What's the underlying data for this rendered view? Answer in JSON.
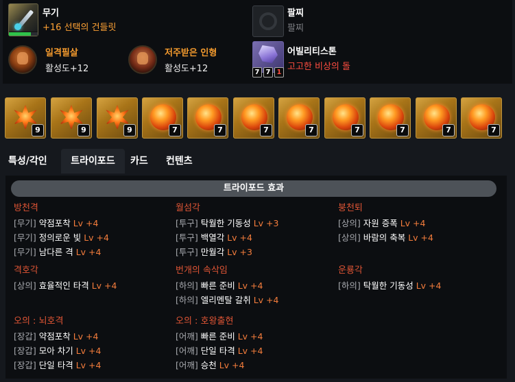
{
  "equipment": {
    "weapon": {
      "label": "무기",
      "value": "+16 선택의 건들릿",
      "durability_fraction": 0.75
    },
    "engravings": [
      {
        "name": "일격필살",
        "activation": "활성도+12"
      },
      {
        "name": "저주받은 인형",
        "activation": "활성도+12"
      }
    ],
    "bracelet": {
      "label": "팔찌",
      "value": "팔찌"
    },
    "ability_stone": {
      "label": "어빌리티스톤",
      "value": "고고한 비상의 돌",
      "levels": [
        "7",
        "7",
        "1"
      ]
    }
  },
  "gems": [
    {
      "type": "burst",
      "level": "9"
    },
    {
      "type": "burst",
      "level": "9"
    },
    {
      "type": "burst",
      "level": "9"
    },
    {
      "type": "orb",
      "level": "7"
    },
    {
      "type": "orb",
      "level": "7"
    },
    {
      "type": "orb",
      "level": "7"
    },
    {
      "type": "orb",
      "level": "7"
    },
    {
      "type": "orb",
      "level": "7"
    },
    {
      "type": "orb",
      "level": "7"
    },
    {
      "type": "orb",
      "level": "7"
    },
    {
      "type": "orb",
      "level": "7"
    }
  ],
  "tabs": [
    {
      "label": "특성/각인",
      "active": false
    },
    {
      "label": "트라이포드",
      "active": true
    },
    {
      "label": "카드",
      "active": false
    },
    {
      "label": "컨텐츠",
      "active": false
    }
  ],
  "tripod": {
    "header": "트라이포드 효과",
    "groups": [
      {
        "title": "방천격",
        "items": [
          {
            "slot": "[무기]",
            "skill": "약점포착",
            "lv": "Lv +4"
          },
          {
            "slot": "[무기]",
            "skill": "정의로운 빛",
            "lv": "Lv +4"
          },
          {
            "slot": "[무기]",
            "skill": "남다른 격",
            "lv": "Lv +4"
          }
        ]
      },
      {
        "title": "월섬각",
        "items": [
          {
            "slot": "[투구]",
            "skill": "탁월한 기동성",
            "lv": "Lv +3"
          },
          {
            "slot": "[투구]",
            "skill": "백열각",
            "lv": "Lv +4"
          },
          {
            "slot": "[투구]",
            "skill": "만월각",
            "lv": "Lv +3"
          }
        ]
      },
      {
        "title": "붕천퇴",
        "items": [
          {
            "slot": "[상의]",
            "skill": "자원 증폭",
            "lv": "Lv +4"
          },
          {
            "slot": "[상의]",
            "skill": "바람의 축복",
            "lv": "Lv +4"
          }
        ]
      },
      {
        "title": "격호각",
        "items": [
          {
            "slot": "[상의]",
            "skill": "효율적인 타격",
            "lv": "Lv +4"
          }
        ]
      },
      {
        "title": "번개의 속삭임",
        "items": [
          {
            "slot": "[하의]",
            "skill": "빠른 준비",
            "lv": "Lv +4"
          },
          {
            "slot": "[하의]",
            "skill": "엘리멘탈 갈취",
            "lv": "Lv +4"
          }
        ]
      },
      {
        "title": "운룡각",
        "items": [
          {
            "slot": "[하의]",
            "skill": "탁월한 기동성",
            "lv": "Lv +4"
          }
        ]
      },
      {
        "title": "오의 : 뇌호격",
        "items": [
          {
            "slot": "[장갑]",
            "skill": "약점포착",
            "lv": "Lv +4"
          },
          {
            "slot": "[장갑]",
            "skill": "모아 차기",
            "lv": "Lv +4"
          },
          {
            "slot": "[장갑]",
            "skill": "단일 타격",
            "lv": "Lv +4"
          }
        ]
      },
      {
        "title": "오의 : 호왕출현",
        "items": [
          {
            "slot": "[어깨]",
            "skill": "빠른 준비",
            "lv": "Lv +4"
          },
          {
            "slot": "[어깨]",
            "skill": "단일 타격",
            "lv": "Lv +4"
          },
          {
            "slot": "[어깨]",
            "skill": "승천",
            "lv": "Lv +4"
          }
        ]
      }
    ]
  }
}
